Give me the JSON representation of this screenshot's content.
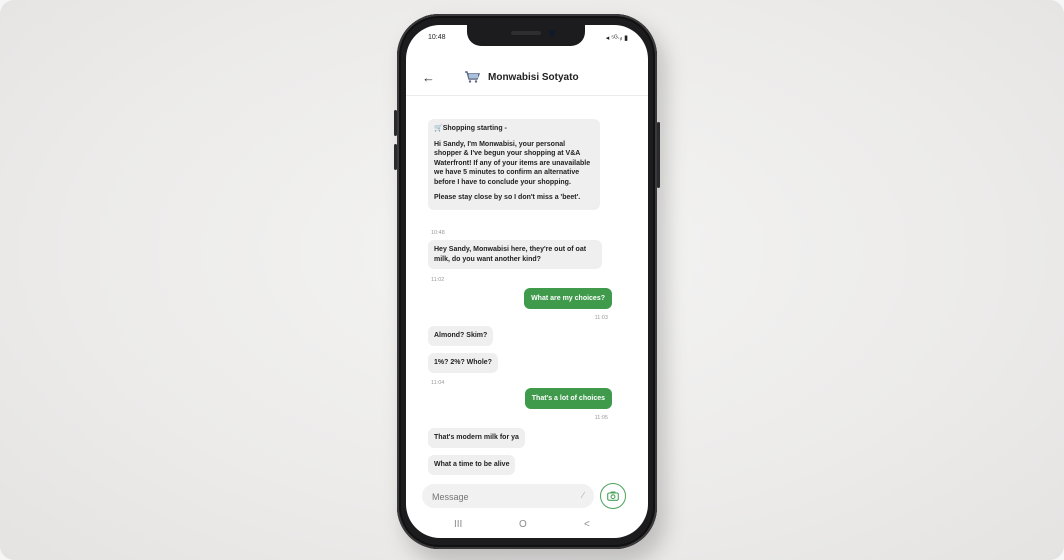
{
  "status_bar": {
    "time": "10:48",
    "indicators": "◂ ⁵ᴳ·ᵢₗ ▮"
  },
  "header": {
    "back_icon": "arrow-left-icon",
    "contact_name": "Monwabisi Sotyato",
    "cart_icon": "shopping-cart-icon"
  },
  "messages": [
    {
      "dir": "in",
      "title": "Shopping starting -",
      "body": "Hi Sandy, I'm Monwabisi, your personal shopper & I've begun your shopping at V&A Waterfront! If any of your items are unavailable we have 5 minutes to confirm an alternative before I have to conclude your shopping.",
      "footer": "Please stay close by so I don't miss a 'beet'.",
      "time": "10:48"
    },
    {
      "dir": "in",
      "text": "Hey Sandy, Monwabisi here, they're out of oat milk, do you want another kind?",
      "time": "11:02"
    },
    {
      "dir": "out",
      "text": "What are my choices?",
      "time": "11:03"
    },
    {
      "dir": "in",
      "text": "Almond? Skim?"
    },
    {
      "dir": "in",
      "text": "1%? 2%? Whole?",
      "time": "11:04"
    },
    {
      "dir": "out",
      "text": "That's a lot of choices",
      "time": "11:05"
    },
    {
      "dir": "in",
      "text": "That's modern milk for ya"
    },
    {
      "dir": "in",
      "text": "What a time to be alive"
    }
  ],
  "composer": {
    "placeholder": "Message",
    "attach_icon": "paperclip-icon",
    "camera_icon": "camera-icon"
  },
  "nav_bar": {
    "recents": "III",
    "home": "O",
    "back": "<"
  },
  "colors": {
    "accent_green": "#3f9a4c",
    "incoming_bubble": "#efefef"
  }
}
